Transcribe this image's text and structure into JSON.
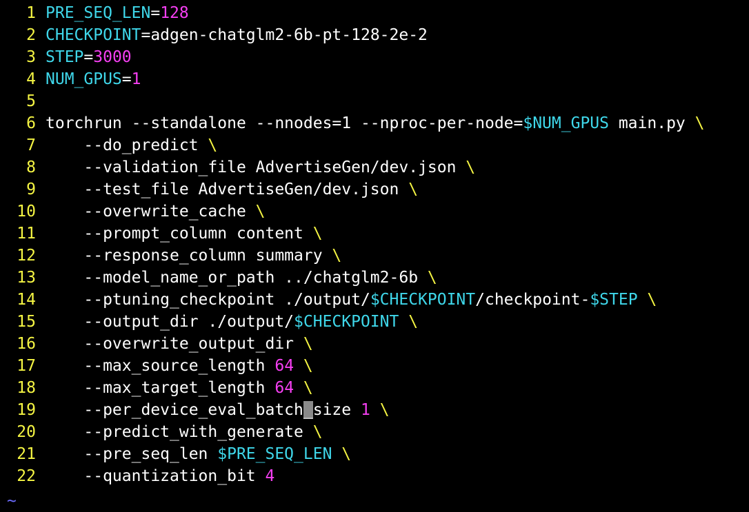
{
  "colors": {
    "background": "#000000",
    "line_number": "#f5f543",
    "variable": "#3fd7ea",
    "number": "#f63ff3",
    "plain_text": "#ffffff",
    "continuation": "#f5f543",
    "cursor": "#8a8a8a",
    "tilde": "#6c6cff"
  },
  "lines": [
    {
      "num": "1",
      "tokens": [
        {
          "t": "PRE_SEQ_LEN",
          "c": "var"
        },
        {
          "t": "=",
          "c": "plain"
        },
        {
          "t": "128",
          "c": "num"
        }
      ]
    },
    {
      "num": "2",
      "tokens": [
        {
          "t": "CHECKPOINT",
          "c": "var"
        },
        {
          "t": "=adgen-chatglm2-6b-pt-128-2e-2",
          "c": "plain"
        }
      ]
    },
    {
      "num": "3",
      "tokens": [
        {
          "t": "STEP",
          "c": "var"
        },
        {
          "t": "=",
          "c": "plain"
        },
        {
          "t": "3000",
          "c": "num"
        }
      ]
    },
    {
      "num": "4",
      "tokens": [
        {
          "t": "NUM_GPUS",
          "c": "var"
        },
        {
          "t": "=",
          "c": "plain"
        },
        {
          "t": "1",
          "c": "num"
        }
      ]
    },
    {
      "num": "5",
      "tokens": []
    },
    {
      "num": "6",
      "tokens": [
        {
          "t": "torchrun --standalone --nnodes=1 --nproc-per-node=",
          "c": "plain"
        },
        {
          "t": "$NUM_GPUS",
          "c": "var"
        },
        {
          "t": " main.py ",
          "c": "plain"
        },
        {
          "t": "\\",
          "c": "cont"
        }
      ]
    },
    {
      "num": "7",
      "tokens": [
        {
          "t": "    --do_predict ",
          "c": "plain"
        },
        {
          "t": "\\",
          "c": "cont"
        }
      ]
    },
    {
      "num": "8",
      "tokens": [
        {
          "t": "    --validation_file AdvertiseGen/dev.json ",
          "c": "plain"
        },
        {
          "t": "\\",
          "c": "cont"
        }
      ]
    },
    {
      "num": "9",
      "tokens": [
        {
          "t": "    --test_file AdvertiseGen/dev.json ",
          "c": "plain"
        },
        {
          "t": "\\",
          "c": "cont"
        }
      ]
    },
    {
      "num": "10",
      "tokens": [
        {
          "t": "    --overwrite_cache ",
          "c": "plain"
        },
        {
          "t": "\\",
          "c": "cont"
        }
      ]
    },
    {
      "num": "11",
      "tokens": [
        {
          "t": "    --prompt_column content ",
          "c": "plain"
        },
        {
          "t": "\\",
          "c": "cont"
        }
      ]
    },
    {
      "num": "12",
      "tokens": [
        {
          "t": "    --response_column summary ",
          "c": "plain"
        },
        {
          "t": "\\",
          "c": "cont"
        }
      ]
    },
    {
      "num": "13",
      "tokens": [
        {
          "t": "    --model_name_or_path ../chatglm2-6b ",
          "c": "plain"
        },
        {
          "t": "\\",
          "c": "cont"
        }
      ]
    },
    {
      "num": "14",
      "tokens": [
        {
          "t": "    --ptuning_checkpoint ./output/",
          "c": "plain"
        },
        {
          "t": "$CHECKPOINT",
          "c": "var"
        },
        {
          "t": "/checkpoint-",
          "c": "plain"
        },
        {
          "t": "$STEP",
          "c": "var"
        },
        {
          "t": " ",
          "c": "plain"
        },
        {
          "t": "\\",
          "c": "cont"
        }
      ]
    },
    {
      "num": "15",
      "tokens": [
        {
          "t": "    --output_dir ./output/",
          "c": "plain"
        },
        {
          "t": "$CHECKPOINT",
          "c": "var"
        },
        {
          "t": " ",
          "c": "plain"
        },
        {
          "t": "\\",
          "c": "cont"
        }
      ]
    },
    {
      "num": "16",
      "tokens": [
        {
          "t": "    --overwrite_output_dir ",
          "c": "plain"
        },
        {
          "t": "\\",
          "c": "cont"
        }
      ]
    },
    {
      "num": "17",
      "tokens": [
        {
          "t": "    --max_source_length ",
          "c": "plain"
        },
        {
          "t": "64",
          "c": "num"
        },
        {
          "t": " ",
          "c": "plain"
        },
        {
          "t": "\\",
          "c": "cont"
        }
      ]
    },
    {
      "num": "18",
      "tokens": [
        {
          "t": "    --max_target_length ",
          "c": "plain"
        },
        {
          "t": "64",
          "c": "num"
        },
        {
          "t": " ",
          "c": "plain"
        },
        {
          "t": "\\",
          "c": "cont"
        }
      ]
    },
    {
      "num": "19",
      "tokens": [
        {
          "t": "    --per_device_eval_batch",
          "c": "plain"
        },
        {
          "t": "_",
          "c": "cursor"
        },
        {
          "t": "size ",
          "c": "plain"
        },
        {
          "t": "1",
          "c": "num"
        },
        {
          "t": " ",
          "c": "plain"
        },
        {
          "t": "\\",
          "c": "cont"
        }
      ]
    },
    {
      "num": "20",
      "tokens": [
        {
          "t": "    --predict_with_generate ",
          "c": "plain"
        },
        {
          "t": "\\",
          "c": "cont"
        }
      ]
    },
    {
      "num": "21",
      "tokens": [
        {
          "t": "    --pre_seq_len ",
          "c": "plain"
        },
        {
          "t": "$PRE_SEQ_LEN",
          "c": "var"
        },
        {
          "t": " ",
          "c": "plain"
        },
        {
          "t": "\\",
          "c": "cont"
        }
      ]
    },
    {
      "num": "22",
      "tokens": [
        {
          "t": "    --quantization_bit ",
          "c": "plain"
        },
        {
          "t": "4",
          "c": "num"
        }
      ]
    }
  ],
  "empty_line_marker": "~"
}
